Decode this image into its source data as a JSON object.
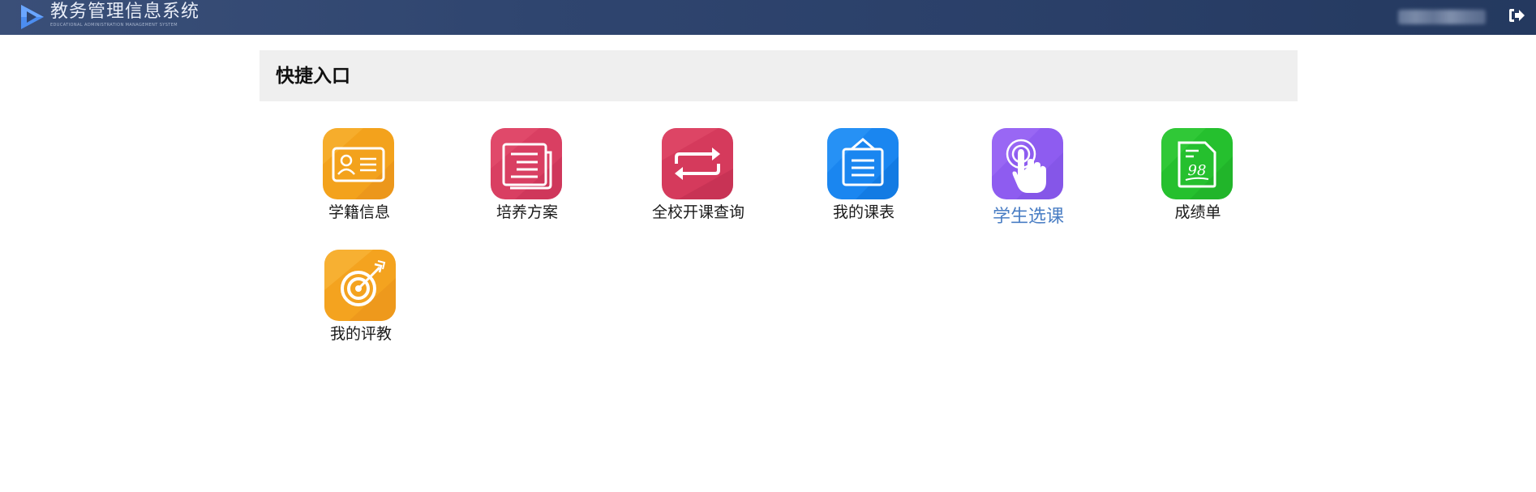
{
  "header": {
    "brand_title": "教务管理信息系统",
    "brand_subtitle": "EDUCATIONAL ADMINISTRATION MANAGEMENT SYSTEM",
    "logo_icon": "play-triangle-logo",
    "logout_icon": "sign-out-icon"
  },
  "panel": {
    "title": "快捷入口"
  },
  "shortcuts": [
    {
      "label": "学籍信息",
      "icon": "id-card-icon",
      "color": "#f3a21c"
    },
    {
      "label": "培养方案",
      "icon": "document-icon",
      "color": "#d93f62"
    },
    {
      "label": "全校开课查询",
      "icon": "swap-arrows-icon",
      "color": "#d53a5c"
    },
    {
      "label": "我的课表",
      "icon": "hanging-board-icon",
      "color": "#1a86f0"
    },
    {
      "label": "学生选课",
      "icon": "finger-tap-icon",
      "color": "#8e5cf0",
      "active": true
    },
    {
      "label": "成绩单",
      "icon": "grade-sheet-icon",
      "color": "#25c02e"
    },
    {
      "label": "我的评教",
      "icon": "target-arrow-icon",
      "color": "#f4a31f"
    }
  ],
  "colors": {
    "header_bg": "#2f456f",
    "panel_bg": "#efefef",
    "active_label": "#4a7ec4"
  }
}
